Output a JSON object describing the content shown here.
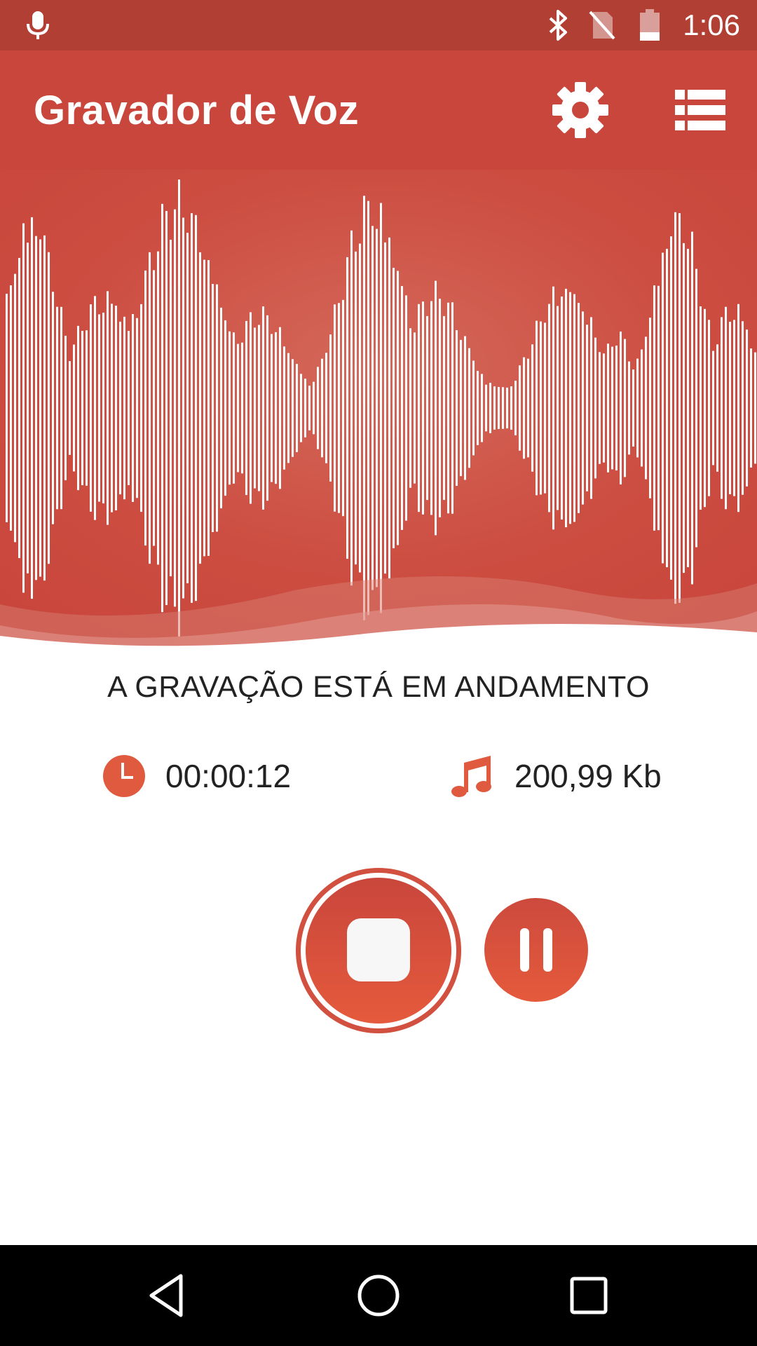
{
  "status_bar": {
    "time": "1:06",
    "icons": [
      "mic-icon",
      "bluetooth-icon",
      "no-sim-icon",
      "battery-icon"
    ]
  },
  "header": {
    "title": "Gravador de Voz",
    "actions": [
      "settings-icon",
      "list-icon"
    ]
  },
  "recording": {
    "status_text": "A GRAVAÇÃO ESTÁ EM ANDAMENTO",
    "elapsed_time": "00:00:12",
    "file_size": "200,99 Kb",
    "time_icon": "clock-icon",
    "size_icon": "music-note-icon"
  },
  "controls": {
    "stop_icon": "stop-icon",
    "pause_icon": "pause-icon"
  },
  "nav_bar": {
    "buttons": [
      "back-icon",
      "home-icon",
      "recents-icon"
    ]
  },
  "colors": {
    "status_bar": "#b23f34",
    "primary": "#c9463c",
    "accent": "#e05a3f",
    "white": "#ffffff"
  }
}
